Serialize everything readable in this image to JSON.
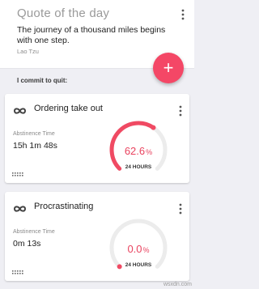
{
  "quote": {
    "title": "Quote of the day",
    "text": "The journey of a thousand miles begins with one step.",
    "author": "Lao Tzu"
  },
  "fab": {
    "label": "+"
  },
  "commit_label": "I commit to quit:",
  "habits": [
    {
      "name": "Ordering take out",
      "abstinence_label": "Abstinence Time",
      "abstinence_value": "15h 1m 48s",
      "progress_number": "62.6",
      "progress_sign": "%",
      "progress_fraction": 0.626,
      "gauge_label": "24 HOURS"
    },
    {
      "name": "Procrastinating",
      "abstinence_label": "Abstinence Time",
      "abstinence_value": "0m 13s",
      "progress_number": "0.0",
      "progress_sign": "%",
      "progress_fraction": 0.0,
      "gauge_label": "24 HOURS"
    }
  ],
  "colors": {
    "accent": "#f44766",
    "gauge_track": "#ececec",
    "gauge_fill": "#f04a63"
  },
  "watermark": "wsxdn.com"
}
